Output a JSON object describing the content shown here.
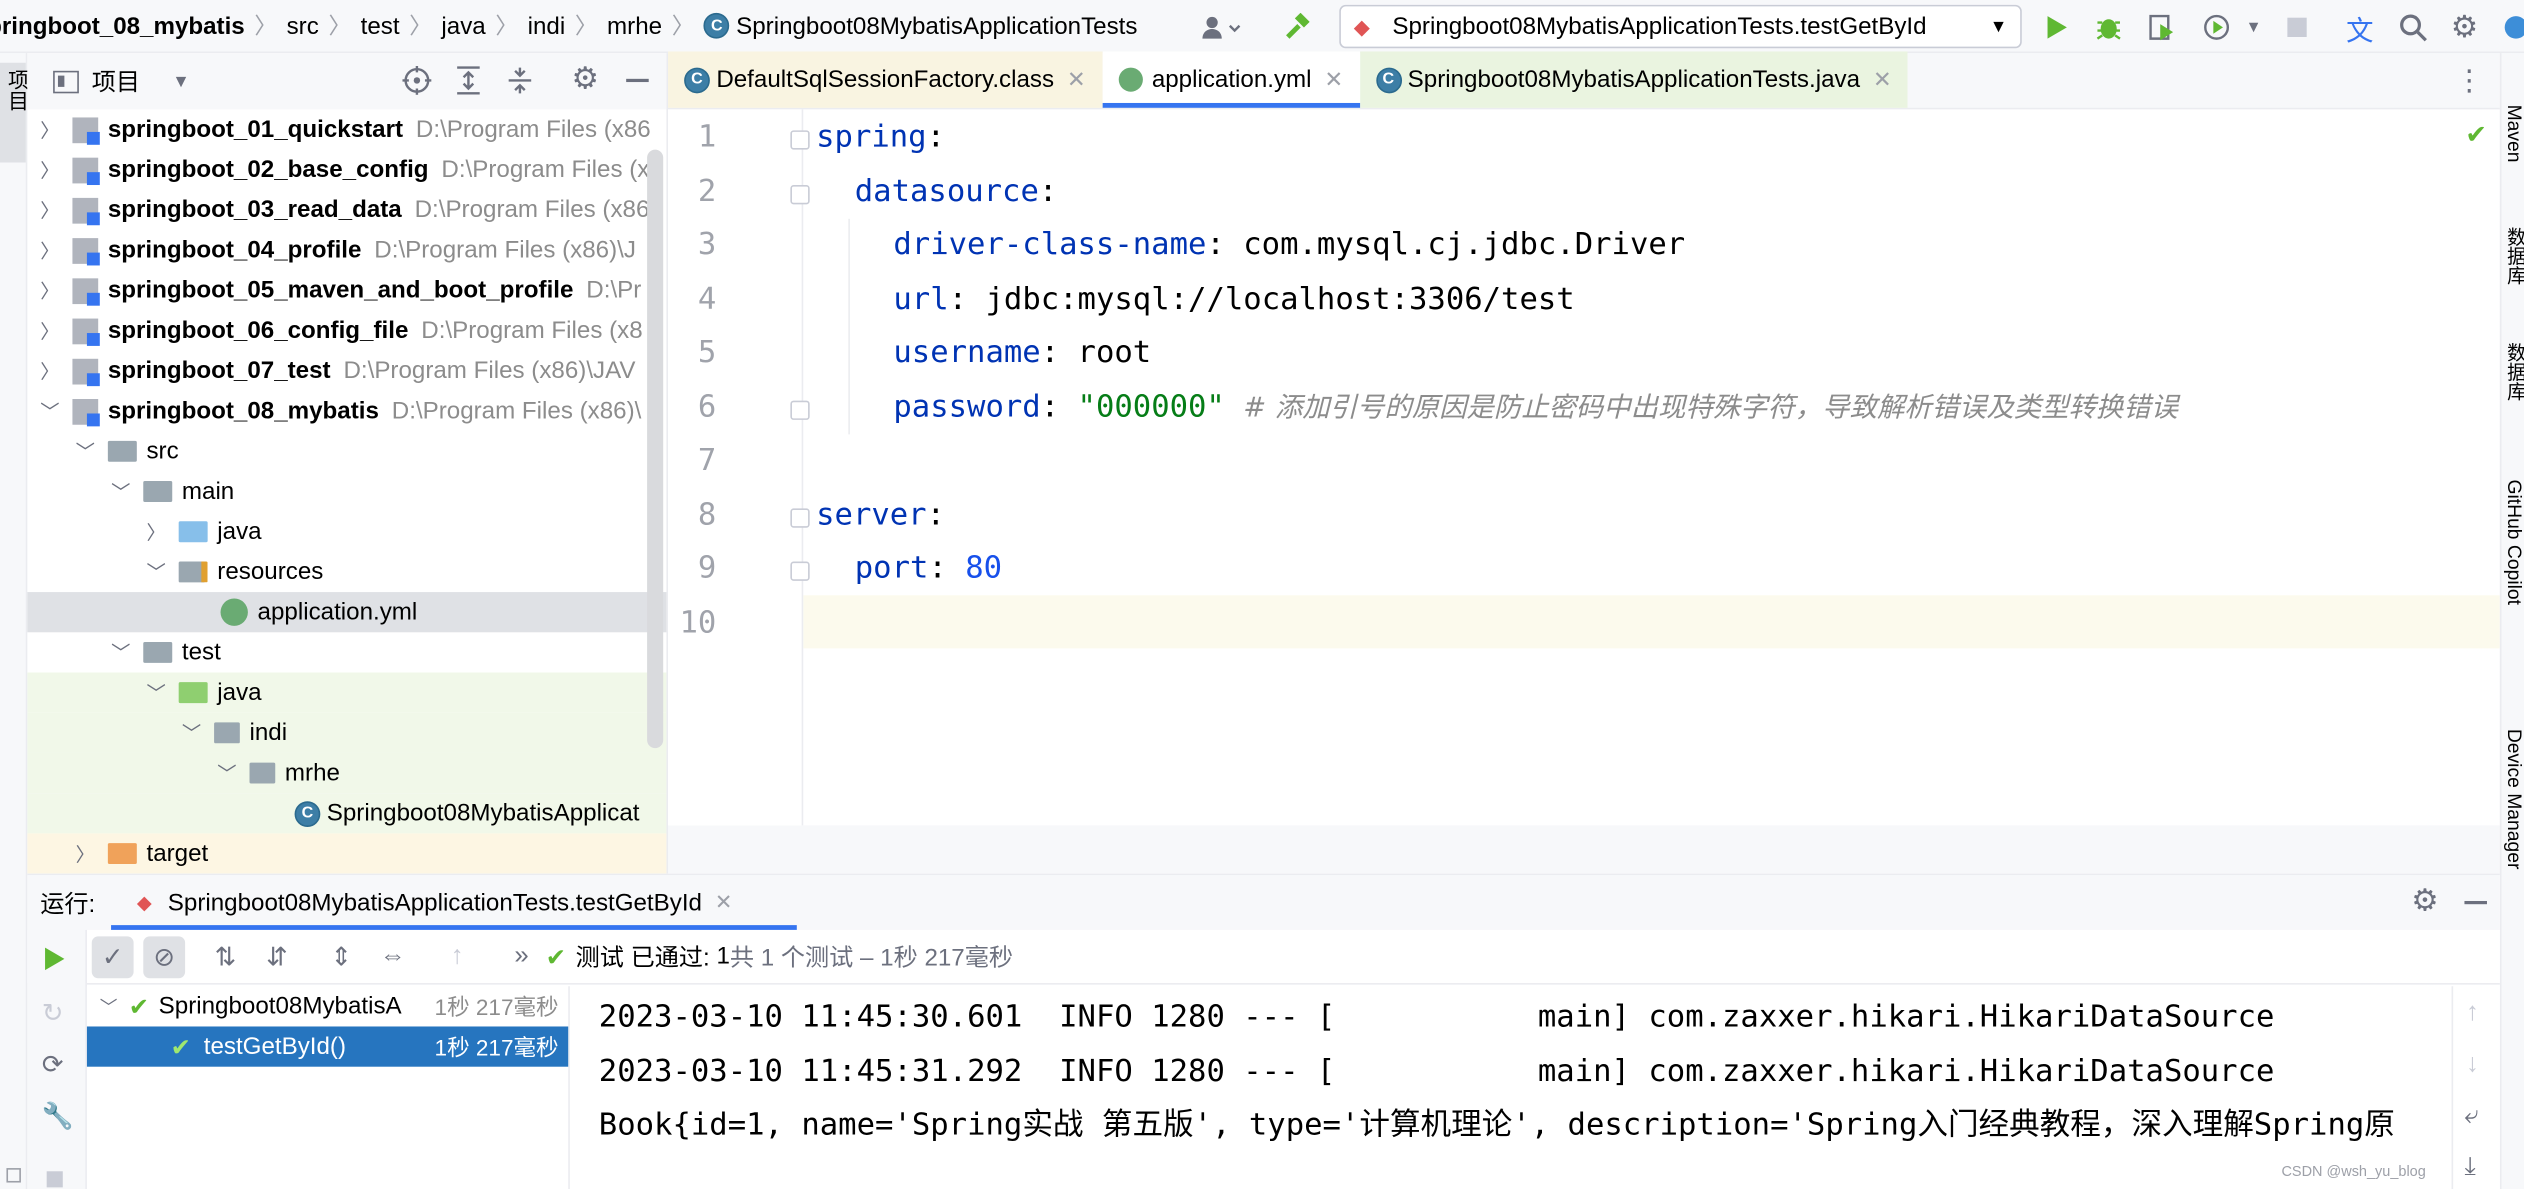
{
  "breadcrumb": {
    "items": [
      "pringboot_08_mybatis",
      "src",
      "test",
      "java",
      "indi",
      "mrhe"
    ],
    "current": "Springboot08MybatisApplicationTests"
  },
  "run_config": {
    "label": "Springboot08MybatisApplicationTests.testGetById"
  },
  "project_panel": {
    "title": "项目",
    "modules": [
      {
        "name": "springboot_01_quickstart",
        "path": "D:\\Program Files (x86"
      },
      {
        "name": "springboot_02_base_config",
        "path": "D:\\Program Files (x"
      },
      {
        "name": "springboot_03_read_data",
        "path": "D:\\Program Files (x86"
      },
      {
        "name": "springboot_04_profile",
        "path": "D:\\Program Files (x86)\\J"
      },
      {
        "name": "springboot_05_maven_and_boot_profile",
        "path": "D:\\Pr"
      },
      {
        "name": "springboot_06_config_file",
        "path": "D:\\Program Files (x8"
      },
      {
        "name": "springboot_07_test",
        "path": "D:\\Program Files (x86)\\JAV"
      },
      {
        "name": "springboot_08_mybatis",
        "path": "D:\\Program Files (x86)\\"
      }
    ],
    "nodes": {
      "src": "src",
      "main": "main",
      "java_main": "java",
      "resources": "resources",
      "application_yml": "application.yml",
      "test": "test",
      "java_test": "java",
      "indi": "indi",
      "mrhe": "mrhe",
      "test_class": "Springboot08MybatisApplicat",
      "target": "target"
    }
  },
  "left_strip": {
    "label": "项目"
  },
  "right_strip": {
    "labels": [
      "Maven",
      "数据库",
      "数据库",
      "GitHub Copilot",
      "Device Manager"
    ]
  },
  "editor_tabs": [
    {
      "label": "DefaultSqlSessionFactory.class"
    },
    {
      "label": "application.yml"
    },
    {
      "label": "Springboot08MybatisApplicationTests.java"
    }
  ],
  "editor": {
    "line_numbers": [
      "1",
      "2",
      "3",
      "4",
      "5",
      "6",
      "7",
      "8",
      "9",
      "10"
    ],
    "lines": {
      "l1_key": "spring",
      "l2_key": "datasource",
      "l3_key": "driver-class-name",
      "l3_val": "com.mysql.cj.jdbc.Driver",
      "l4_key": "url",
      "l4_val": "jdbc:mysql://localhost:3306/test",
      "l5_key": "username",
      "l5_val": "root",
      "l6_key": "password",
      "l6_val": "\"000000\"",
      "l6_comment": "# 添加引号的原因是防止密码中出现特殊字符，导致解析错误及类型转换错误",
      "l8_key": "server",
      "l9_key": "port",
      "l9_val": "80"
    }
  },
  "run_panel": {
    "label": "运行:",
    "tab": "Springboot08MybatisApplicationTests.testGetById",
    "status_prefix": "测试 已通过: ",
    "status_count": "1",
    "status_suffix": "共 1 个测试 – 1秒 217毫秒",
    "tree": [
      {
        "name": "Springboot08MybatisA",
        "time": "1秒 217毫秒"
      },
      {
        "name": "testGetById()",
        "time": "1秒 217毫秒"
      }
    ],
    "console": [
      "2023-03-10 11:45:30.601  INFO 1280 --- [           main] com.zaxxer.hikari.HikariDataSource",
      "2023-03-10 11:45:31.292  INFO 1280 --- [           main] com.zaxxer.hikari.HikariDataSource",
      "Book{id=1, name='Spring实战 第五版', type='计算机理论', description='Spring入门经典教程，深入理解Spring原"
    ]
  },
  "watermark": "CSDN @wsh_yu_blog",
  "colors": {
    "accent": "#3574f0",
    "keyword": "#0033b3",
    "string": "#067d17",
    "number": "#1750eb",
    "comment": "#8c8c8c",
    "pass": "#5fb832"
  }
}
